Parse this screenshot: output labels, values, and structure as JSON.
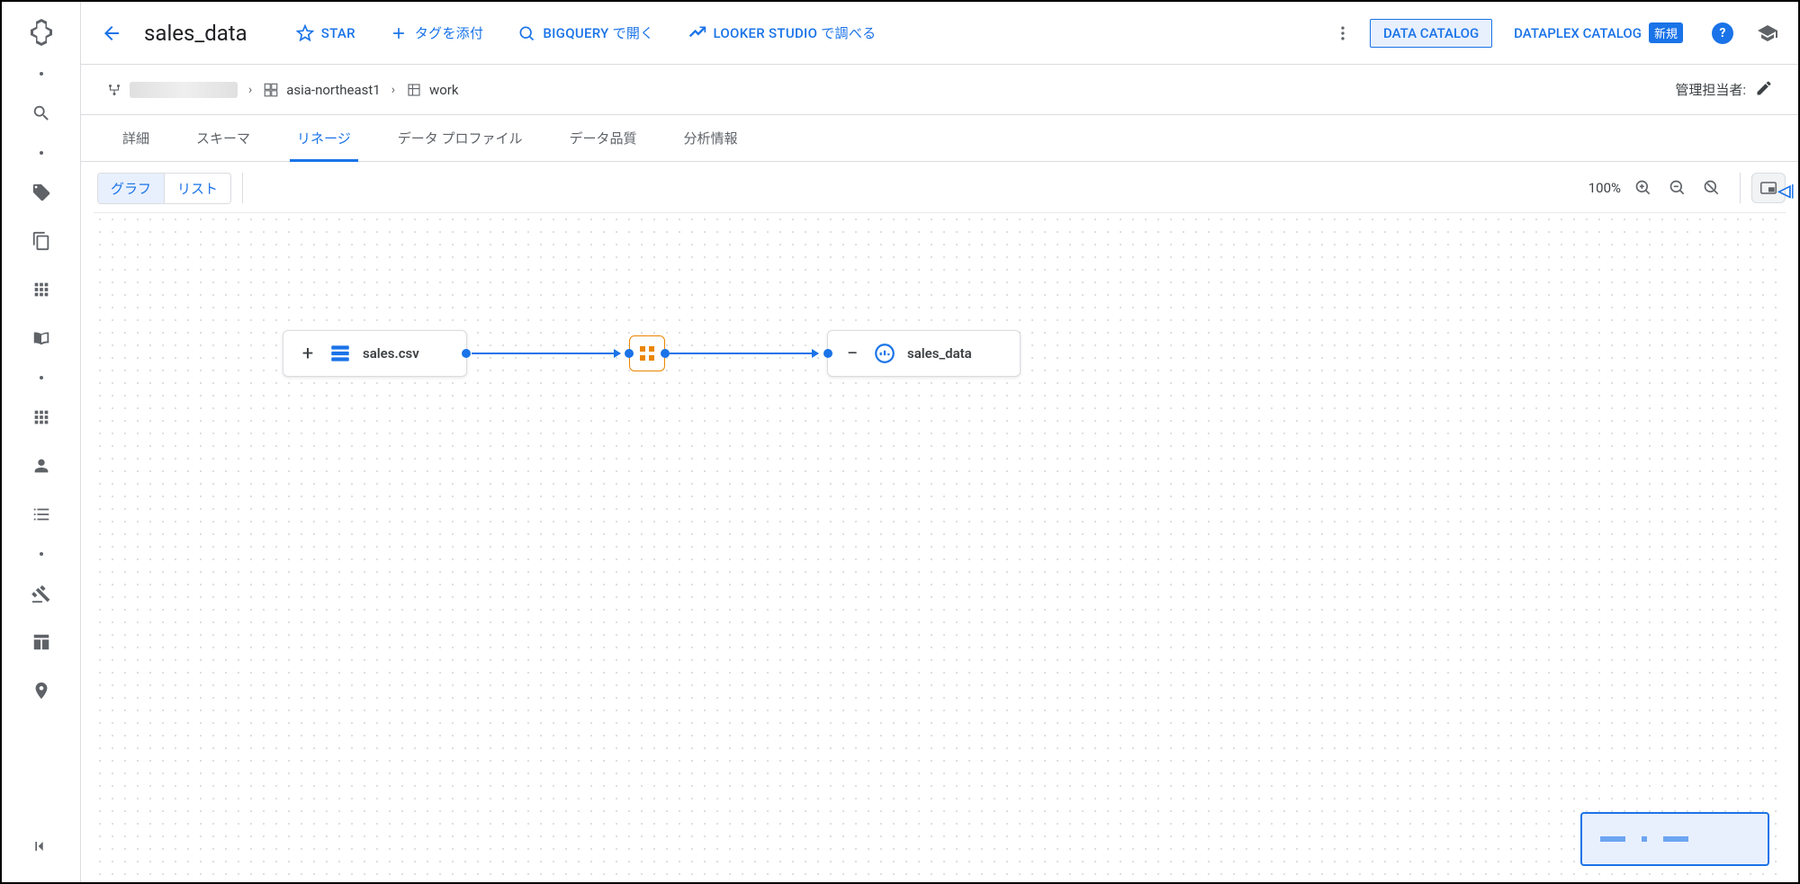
{
  "header": {
    "title": "sales_data",
    "actions": {
      "star": "STAR",
      "attach_tag": "タグを添付",
      "open_bigquery": "BIGQUERY で開く",
      "looker_studio": "LOOKER STUDIO で調べる"
    },
    "catalog_buttons": {
      "data_catalog": "DATA CATALOG",
      "dataplex_catalog": "DATAPLEX CATALOG",
      "new_badge": "新規"
    }
  },
  "breadcrumb": {
    "region": "asia-northeast1",
    "dataset": "work",
    "owner_label": "管理担当者:"
  },
  "tabs": {
    "detail": "詳細",
    "schema": "スキーマ",
    "lineage": "リネージ",
    "data_profile": "データ プロファイル",
    "data_quality": "データ品質",
    "insights": "分析情報"
  },
  "toolbar": {
    "view_graph": "グラフ",
    "view_list": "リスト",
    "zoom_label": "100%"
  },
  "lineage": {
    "nodes": {
      "source": {
        "label": "sales.csv",
        "expand": "+"
      },
      "target": {
        "label": "sales_data",
        "expand": "−"
      }
    }
  }
}
